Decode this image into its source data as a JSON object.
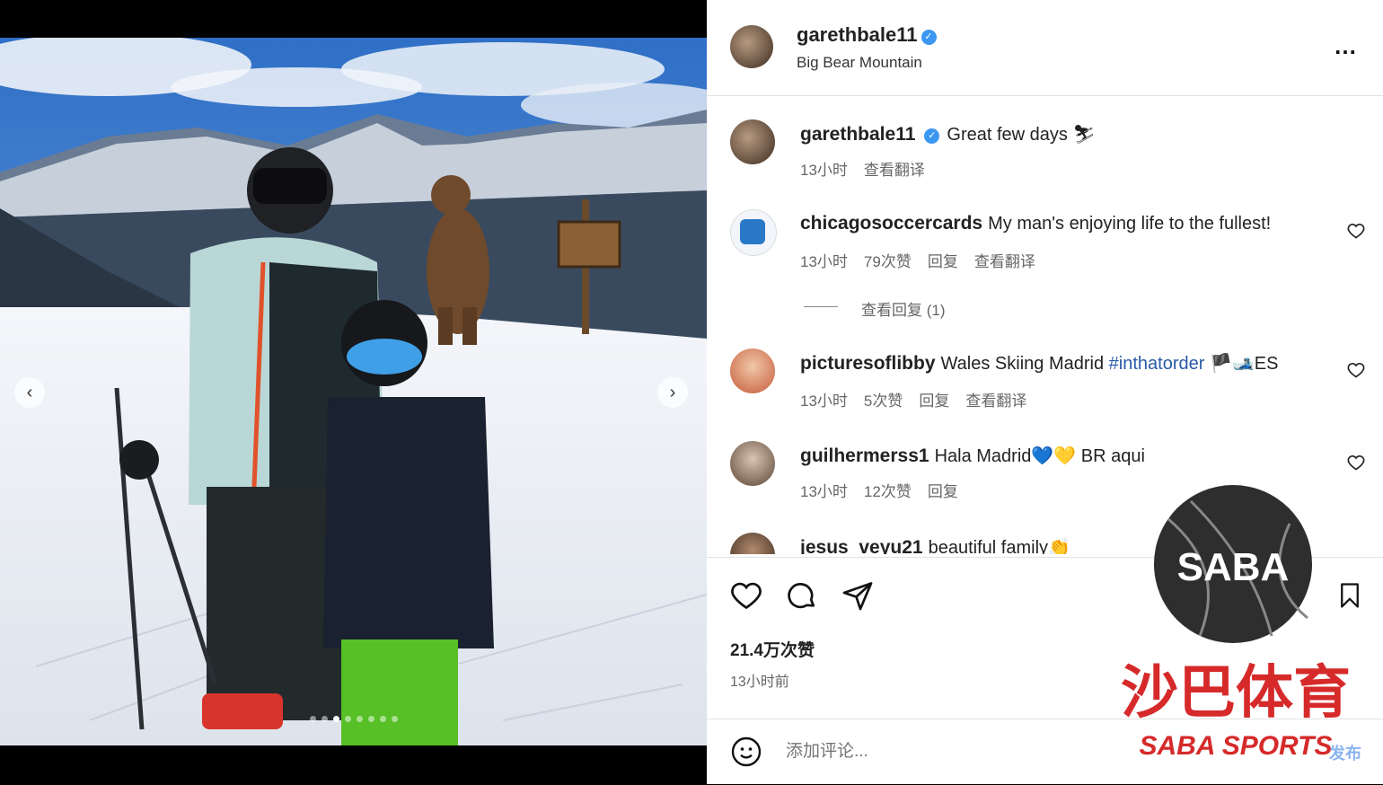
{
  "post": {
    "username": "garethbale11",
    "location": "Big Bear Mountain",
    "more_icon": "…",
    "verified_icon": "✓"
  },
  "comments": [
    {
      "username": "garethbale11",
      "text": "Great few days ⛷",
      "time": "13小时",
      "translate": "查看翻译"
    },
    {
      "username": "chicagosoccercards",
      "text": "My man's enjoying life to the fullest!",
      "time": "13小时",
      "likes": "79次赞",
      "reply": "回复",
      "translate": "查看翻译",
      "view_replies": "查看回复 (1)"
    },
    {
      "username": "picturesoflibby",
      "text_a": "Wales Skiing Madrid ",
      "hashtag": "#inthatorder",
      "text_b": " 🏴🎿ES",
      "time": "13小时",
      "likes": "5次赞",
      "reply": "回复",
      "translate": "查看翻译"
    },
    {
      "username": "guilhermerss1",
      "text": "Hala Madrid💙💛 BR aqui",
      "time": "13小时",
      "likes": "12次赞",
      "reply": "回复"
    },
    {
      "username": "jesus_veyu21",
      "text": "beautiful family👏"
    }
  ],
  "footer": {
    "likes": "21.4万次赞",
    "time": "13小时前",
    "comment_placeholder": "添加评论...",
    "post_label": "发布"
  },
  "media": {
    "dots_total": 8,
    "dots_active": 2,
    "prev": "‹",
    "next": "›"
  },
  "watermark": {
    "logo": "SABA",
    "cn": "沙巴体育",
    "en": "SABA SPORTS"
  }
}
